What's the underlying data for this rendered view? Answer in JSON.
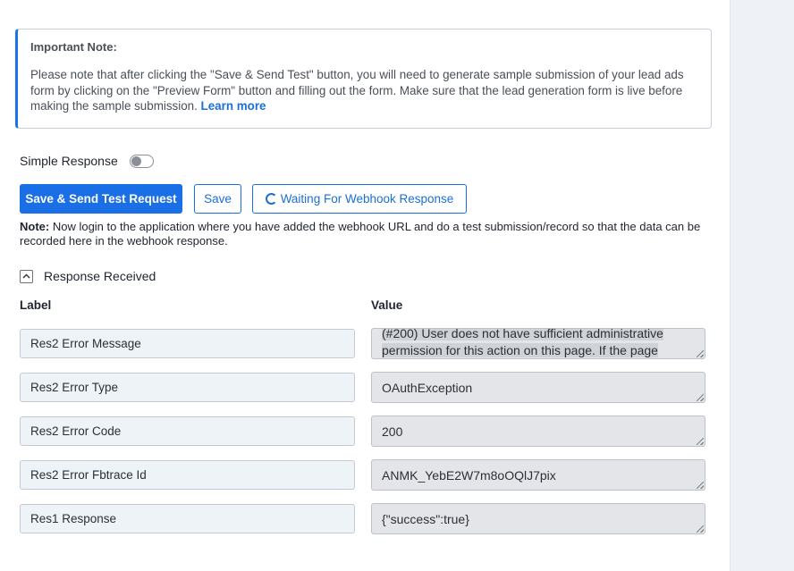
{
  "note": {
    "title": "Important Note:",
    "text": "Please note that after clicking the \"Save & Send Test\" button, you will need to generate sample submission of your lead ads form by clicking on the \"Preview Form\" button and filling out the form. Make sure that the lead generation form is live before making the sample submission.",
    "link": "Learn more"
  },
  "simple_response": {
    "label": "Simple Response",
    "enabled": false
  },
  "buttons": {
    "save_send": "Save & Send Test Request",
    "save": "Save",
    "waiting": "Waiting For Webhook Response"
  },
  "instructions": {
    "bold": "Note:",
    "text": " Now login to the application where you have added the webhook URL and do a test submission/record so that the data can be recorded here in the webhook response."
  },
  "response": {
    "section_label": "Response Received",
    "col_label": "Label",
    "col_value": "Value",
    "rows": [
      {
        "label": "Res2 Error Message",
        "value_lines": [
          "(#200) User does not have sufficient administrative",
          "permission for this action on this page. If the page"
        ]
      },
      {
        "label": "Res2 Error Type",
        "value": "OAuthException"
      },
      {
        "label": "Res2 Error Code",
        "value": "200"
      },
      {
        "label": "Res2 Error Fbtrace Id",
        "value": "ANMK_YebE2W7m8oOQlJ7pix"
      },
      {
        "label": "Res1 Response",
        "value": "{\"success\":true}"
      }
    ]
  }
}
